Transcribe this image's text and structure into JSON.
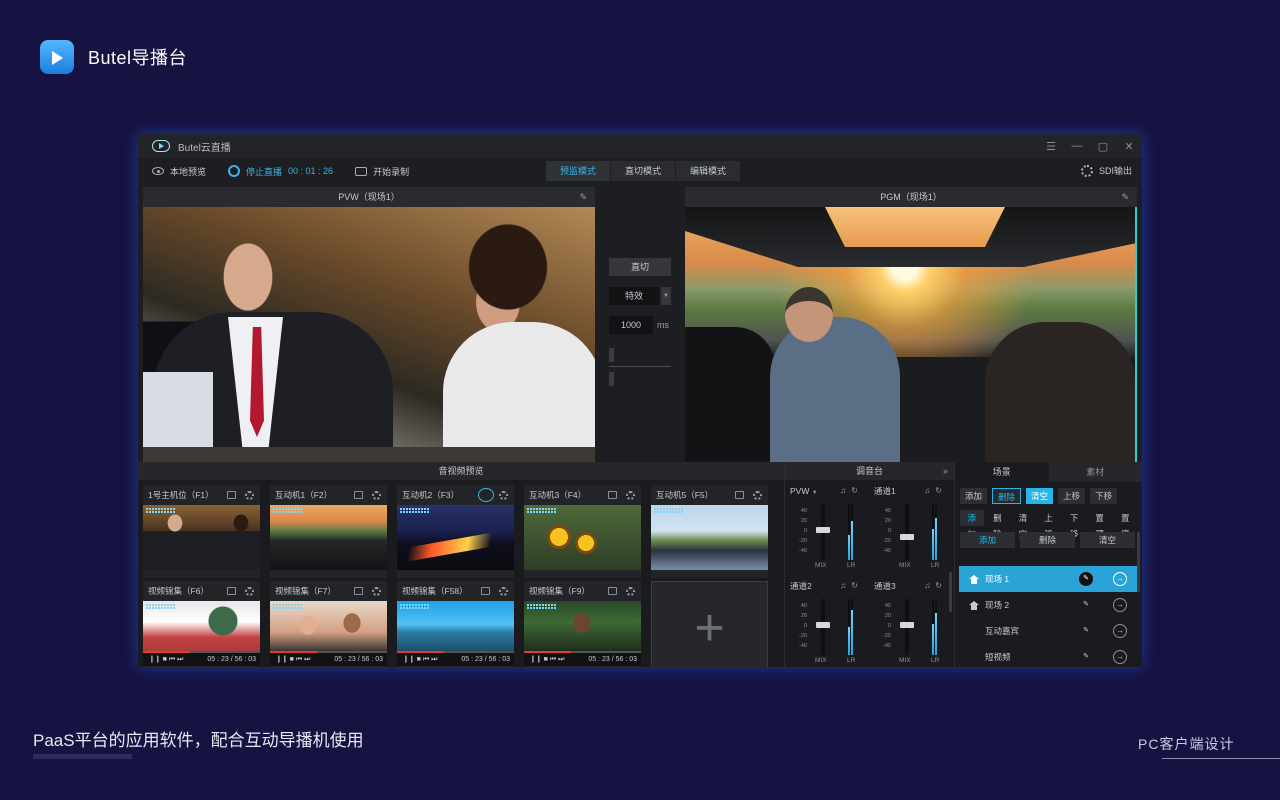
{
  "brand": {
    "title": "Butel导播台"
  },
  "footer": {
    "tagline": "PaaS平台的应用软件，配合互动导播机使用",
    "caption": "PC客户端设计"
  },
  "window": {
    "title": "Butel云直播",
    "controls": [
      "☰",
      "—",
      "▢",
      "✕"
    ]
  },
  "toolbar": {
    "local_preview": "本地预览",
    "stop_live": "停止直播",
    "live_time": "00 : 01 : 26",
    "start_record": "开始录制",
    "modes": [
      "预监模式",
      "直切模式",
      "编辑模式"
    ],
    "active_mode": "预监模式",
    "sdi_output": "SDI输出"
  },
  "monitors": {
    "pvw_title": "PVW（现场1）",
    "pgm_title": "PGM（现场1）"
  },
  "transition": {
    "cut_label": "直切",
    "effect_value": "特效",
    "duration_value": "1000",
    "duration_unit": "ms"
  },
  "av_preview": {
    "title": "音视频预览",
    "tiles": [
      {
        "label": "1号主机位（F1）"
      },
      {
        "label": "互动机1（F2）"
      },
      {
        "label": "互动机2（F3）"
      },
      {
        "label": "互动机3（F4）"
      },
      {
        "label": "互动机5（F5）"
      },
      {
        "label": "视频锦集（F6）",
        "time": "05 : 23 / 56 : 03"
      },
      {
        "label": "视频锦集（F7）",
        "time": "05 : 23 / 56 : 03"
      },
      {
        "label": "视频锦集（F58）",
        "time": "05 : 23 / 56 : 03"
      },
      {
        "label": "视频锦集（F9）",
        "time": "05 : 23 / 56 : 03"
      }
    ],
    "add_symbol": "+"
  },
  "mixer": {
    "title": "调音台",
    "more": "»",
    "scale": [
      "40",
      "20",
      "0",
      "-20",
      "-40"
    ],
    "mix_label": "MIX",
    "lr_label": "LR",
    "channels": [
      {
        "name": "PVW",
        "fader": 0.55,
        "meter_l": 0.45,
        "meter_r": 0.7
      },
      {
        "name": "通道1",
        "fader": 0.4,
        "meter_l": 0.55,
        "meter_r": 0.75
      },
      {
        "name": "通道2",
        "fader": 0.55,
        "meter_l": 0.5,
        "meter_r": 0.8
      },
      {
        "name": "通道3",
        "fader": 0.55,
        "meter_l": 0.55,
        "meter_r": 0.75
      }
    ]
  },
  "scene_panel": {
    "tabs": [
      "场景",
      "素材"
    ],
    "row1": [
      "添加",
      "删除",
      "清空",
      "上移",
      "下移"
    ],
    "row2": [
      "添加",
      "删除",
      "清空",
      "上移",
      "下移",
      "置顶",
      "置底"
    ],
    "row3": [
      "添加",
      "删除",
      "清空"
    ],
    "scenes": [
      {
        "name": "现场 1",
        "active": true,
        "home": true
      },
      {
        "name": "现场 2",
        "active": false,
        "home": true
      },
      {
        "name": "互动嘉宾",
        "active": false,
        "home": false
      },
      {
        "name": "短视频",
        "active": false,
        "home": false
      }
    ]
  },
  "colors": {
    "accent": "#2ab4e6",
    "page_bg": "#161343",
    "pgm_edge": "#2bd0c4"
  }
}
